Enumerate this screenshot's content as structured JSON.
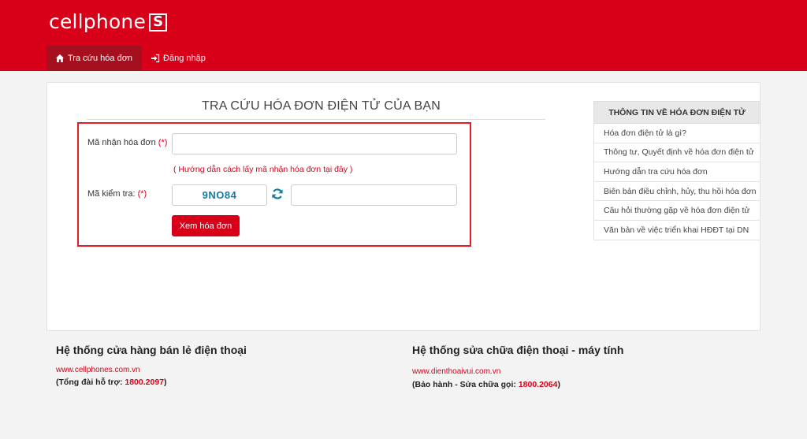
{
  "header": {
    "logo_text": "cellphone",
    "logo_mark": "S",
    "brand_color": "#d70018"
  },
  "nav": {
    "items": [
      {
        "label": "Tra cứu hóa đơn",
        "icon": "home-icon",
        "active": true
      },
      {
        "label": "Đăng nhập",
        "icon": "sign-in-icon",
        "active": false
      }
    ]
  },
  "form": {
    "title": "TRA CỨU HÓA ĐƠN ĐIỆN TỬ CỦA BẠN",
    "invoice_code_label": "Mã nhận hóa đơn",
    "required_mark": "(*)",
    "invoice_code_value": "",
    "hint_link": "( Hướng dẫn cách lấy mã nhận hóa đơn tại đây )",
    "captcha_label": "Mã kiểm tra:",
    "captcha_code": "9NO84",
    "captcha_value": "",
    "submit_label": "Xem hóa đơn"
  },
  "sidebar": {
    "heading": "THÔNG TIN VỀ HÓA ĐƠN ĐIỆN TỬ",
    "items": [
      {
        "label": "Hóa đơn điện tử là gì?"
      },
      {
        "label": "Thông tư, Quyết định về hóa đơn điện tử"
      },
      {
        "label": "Hướng dẫn tra cứu hóa đơn"
      },
      {
        "label": "Biên bản điều chỉnh, hủy, thu hồi hóa đơn"
      },
      {
        "label": "Câu hỏi thường gặp về hóa đơn điện tử"
      },
      {
        "label": "Văn bản về việc triển khai HĐĐT tại DN"
      }
    ]
  },
  "footer": {
    "left": {
      "title": "Hệ thống cửa hàng bán lẻ điện thoại",
      "link": "www.cellphones.com.vn",
      "support_label": "(Tổng đài hỗ trợ:",
      "support_number": "1800.2097",
      "support_close": ")"
    },
    "right": {
      "title": "Hệ thống sửa chữa điện thoại - máy tính",
      "link": "www.dienthoaivui.com.vn",
      "support_label": "(Bảo hành - Sửa chữa gọi:",
      "support_number": "1800.2064",
      "support_close": ")"
    }
  }
}
